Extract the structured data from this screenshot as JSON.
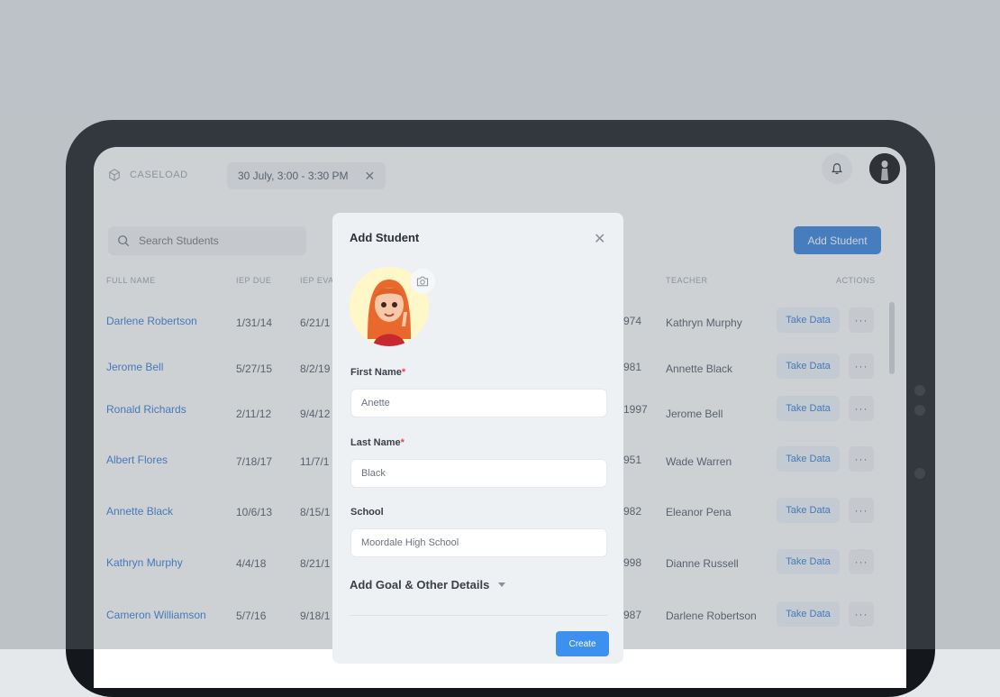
{
  "app": {
    "section": "CASELOAD",
    "session_chip": "30 July, 3:00 - 3:30 PM",
    "close_glyph": "✕"
  },
  "toolbar": {
    "search_placeholder": "Search Students",
    "add_student_label": "Add Student"
  },
  "table": {
    "headers": [
      "FULL NAME",
      "IEP DUE",
      "IEP EVAL",
      "TEACHER",
      "ACTIONS"
    ],
    "take_data_label": "Take Data",
    "more_label": "···",
    "rows": [
      {
        "name": "Darlene Robertson",
        "iep_due": "1/31/14",
        "iep_eval": "6/21/1",
        "year": "974",
        "teacher": "Kathryn Murphy"
      },
      {
        "name": "Jerome Bell",
        "iep_due": "5/27/15",
        "iep_eval": "8/2/19",
        "year": "981",
        "teacher": "Annette Black"
      },
      {
        "name": "Ronald Richards",
        "iep_due": "2/11/12",
        "iep_eval": "9/4/12",
        "year": "1997",
        "teacher": "Jerome Bell"
      },
      {
        "name": "Albert Flores",
        "iep_due": "7/18/17",
        "iep_eval": "11/7/1",
        "year": "951",
        "teacher": "Wade Warren"
      },
      {
        "name": "Annette Black",
        "iep_due": "10/6/13",
        "iep_eval": "8/15/1",
        "year": "982",
        "teacher": "Eleanor Pena"
      },
      {
        "name": "Kathryn Murphy",
        "iep_due": "4/4/18",
        "iep_eval": "8/21/1",
        "year": "998",
        "teacher": "Dianne Russell"
      },
      {
        "name": "Cameron Williamson",
        "iep_due": "5/7/16",
        "iep_eval": "9/18/1",
        "year": "987",
        "teacher": "Darlene Robertson"
      }
    ]
  },
  "modal": {
    "title": "Add Student",
    "close_glyph": "✕",
    "first_name_label": "First Name",
    "first_name_value": "Anette",
    "last_name_label": "Last Name",
    "last_name_value": "Black",
    "school_label": "School",
    "school_value": "Moordale High School",
    "required_mark": "*",
    "goal_toggle": "Add Goal & Other Details",
    "create_label": "Create"
  },
  "colors": {
    "accent": "#2f80e0",
    "link": "#2f7ad6",
    "required": "#e04848"
  }
}
